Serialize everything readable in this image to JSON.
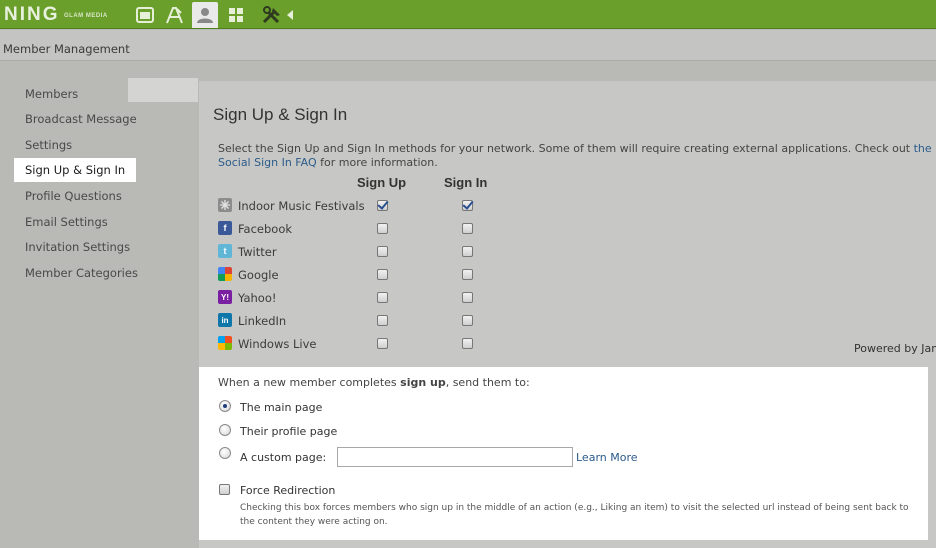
{
  "topbar": {
    "logo": "NING",
    "logo_sub": "GLAM MEDIA",
    "icons": [
      "window-icon",
      "appearance-icon",
      "members-icon",
      "grid-icon",
      "tools-icon",
      "arrow-left-icon"
    ],
    "bg_color": "#6a9f2b"
  },
  "subheader": {
    "title": "Member Management"
  },
  "sidebar": {
    "items": [
      {
        "label": "Members"
      },
      {
        "label": "Broadcast Message"
      },
      {
        "label": "Settings"
      },
      {
        "label": "Sign Up & Sign In",
        "active": true
      },
      {
        "label": "Profile Questions"
      },
      {
        "label": "Email Settings"
      },
      {
        "label": "Invitation Settings"
      },
      {
        "label": "Member Categories"
      }
    ]
  },
  "main": {
    "title": "Sign Up & Sign In",
    "description": "Select the Sign Up and Sign In methods for your network. Some of them will require creating external applications. Check out ",
    "faq_link": "the Social Sign In FAQ",
    "description_end": " for more information.",
    "col_signup": "Sign Up",
    "col_signin": "Sign In",
    "providers": [
      {
        "label": "Indoor Music Festivals",
        "icon": "network-icon",
        "signup": true,
        "signin": true
      },
      {
        "label": "Facebook",
        "icon": "facebook-icon",
        "signup": false,
        "signin": false
      },
      {
        "label": "Twitter",
        "icon": "twitter-icon",
        "signup": false,
        "signin": false
      },
      {
        "label": "Google",
        "icon": "google-icon",
        "signup": false,
        "signin": false
      },
      {
        "label": "Yahoo!",
        "icon": "yahoo-icon",
        "signup": false,
        "signin": false
      },
      {
        "label": "LinkedIn",
        "icon": "linkedin-icon",
        "signup": false,
        "signin": false
      },
      {
        "label": "Windows Live",
        "icon": "windows-live-icon",
        "signup": false,
        "signin": false
      }
    ],
    "powered_by": "Powered by Jan"
  },
  "redirect": {
    "intro_before": "When a new member completes ",
    "intro_bold": "sign up",
    "intro_after": ", send them to:",
    "options": [
      {
        "label": "The main page",
        "checked": true
      },
      {
        "label": "Their profile page",
        "checked": false
      },
      {
        "label": "A custom page:",
        "checked": false
      }
    ],
    "custom_value": "",
    "learn_more": "Learn More",
    "force_label": "Force Redirection",
    "force_checked": false,
    "force_desc": "Checking this box forces members who sign up in the middle of an action (e.g., Liking an item) to visit the selected url instead of being sent back to the content they were acting on."
  }
}
